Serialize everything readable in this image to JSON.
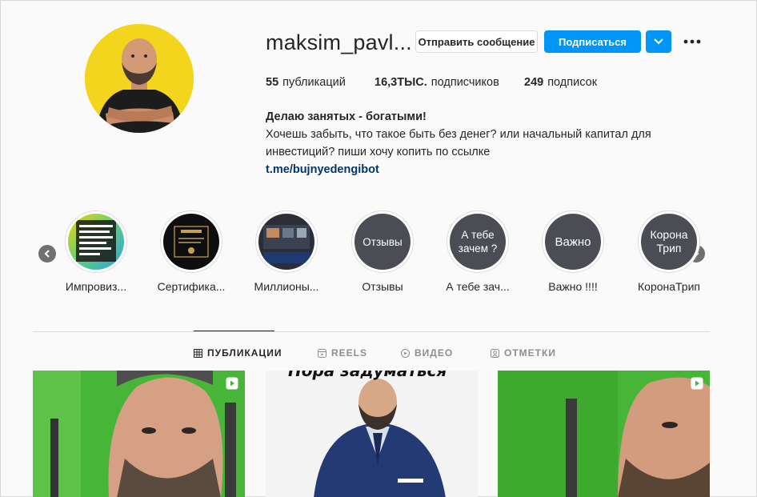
{
  "profile": {
    "username": "maksim_pavl...",
    "message_button": "Отправить сообщение",
    "follow_button": "Подписаться",
    "stats": [
      {
        "count": "55",
        "label": "публикаций"
      },
      {
        "count": "16,3ТЫС.",
        "label": "подписчиков"
      },
      {
        "count": "249",
        "label": "подписок"
      }
    ],
    "bio": {
      "title": "Делаю занятых - богатыми!",
      "line1": "Хочешь забыть, что такое быть без денег? или начальный капитал для",
      "line2": "инвестиций? пиши хочу копить по ссылке",
      "link": "t.me/bujnyedengibot"
    }
  },
  "highlights": [
    {
      "label": "Импровиз...",
      "cover_text": ""
    },
    {
      "label": "Сертифика...",
      "cover_text": ""
    },
    {
      "label": "Миллионы...",
      "cover_text": ""
    },
    {
      "label": "Отзывы",
      "cover_text": "Отзывы"
    },
    {
      "label": "А тебе зач...",
      "cover_text": "А тебе зачем ?"
    },
    {
      "label": "Важно !!!!",
      "cover_text": "Важно"
    },
    {
      "label": "КоронаТрип",
      "cover_text": "Корона Трип"
    }
  ],
  "tabs": [
    {
      "label": "ПУБЛИКАЦИИ",
      "icon": "grid-icon",
      "active": true
    },
    {
      "label": "REELS",
      "icon": "reels-icon",
      "active": false
    },
    {
      "label": "ВИДЕО",
      "icon": "video-icon",
      "active": false
    },
    {
      "label": "ОТМЕТКИ",
      "icon": "tagged-icon",
      "active": false
    }
  ],
  "posts": [
    {
      "type": "reel",
      "caption_text": ""
    },
    {
      "type": "image",
      "caption_text": "Пора задуматься"
    },
    {
      "type": "reel",
      "caption_text": ""
    }
  ],
  "colors": {
    "accent": "#0095f6",
    "avatar_bg": "#f2d51c",
    "link": "#00376b",
    "background": "#fafafa"
  }
}
